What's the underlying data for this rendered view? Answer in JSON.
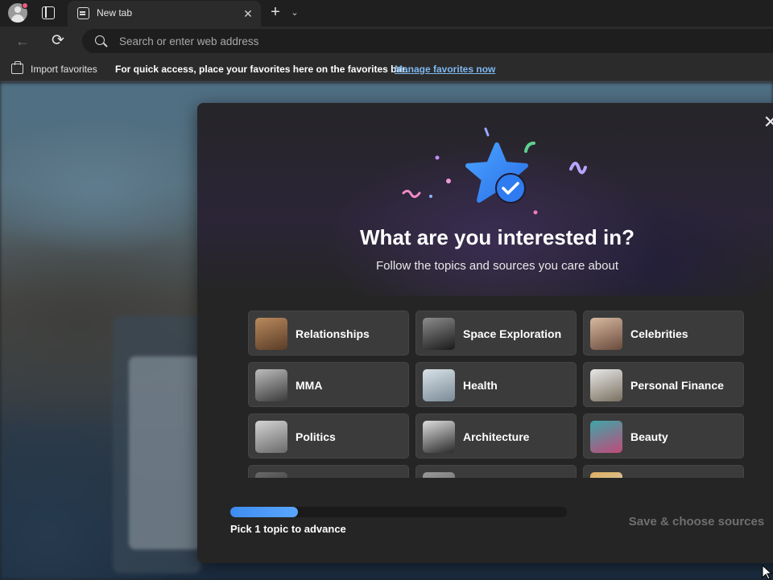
{
  "tab": {
    "title": "New tab",
    "close": "✕"
  },
  "tabbar": {
    "new_tab": "+",
    "dropdown": "⌄"
  },
  "toolbar": {
    "back": "←",
    "refresh": "⟳",
    "search_placeholder": "Search or enter web address",
    "search_value": ""
  },
  "favorites_bar": {
    "import_label": "Import favorites",
    "message": "For quick access, place your favorites here on the favorites bar.",
    "manage_link": "Manage favorites now"
  },
  "dialog": {
    "close": "✕",
    "title": "What are you interested in?",
    "subtitle": "Follow the topics and sources you care about",
    "topics": [
      {
        "label": "Relationships",
        "thumb": [
          "#b98a5e",
          "#5a3c26"
        ]
      },
      {
        "label": "Space Exploration",
        "thumb": [
          "#8c8c8c",
          "#1a1a1a"
        ]
      },
      {
        "label": "Celebrities",
        "thumb": [
          "#d7b9a0",
          "#6a4a3c"
        ]
      },
      {
        "label": "MMA",
        "thumb": [
          "#bdbdbd",
          "#3a3a3a"
        ]
      },
      {
        "label": "Health",
        "thumb": [
          "#d9e2e8",
          "#7a8a96"
        ]
      },
      {
        "label": "Personal Finance",
        "thumb": [
          "#e8e8e8",
          "#7a7060"
        ]
      },
      {
        "label": "Politics",
        "thumb": [
          "#d4d4d4",
          "#6a6a6a"
        ]
      },
      {
        "label": "Architecture",
        "thumb": [
          "#dedede",
          "#2a2a2a"
        ]
      },
      {
        "label": "Beauty",
        "thumb": [
          "#3fa6a8",
          "#c04a7a"
        ]
      },
      {
        "label": "",
        "thumb": [
          "#6a6a6a",
          "#2a2a2a"
        ]
      },
      {
        "label": "",
        "thumb": [
          "#9a9a9a",
          "#5a5a5a"
        ]
      },
      {
        "label": "",
        "thumb": [
          "#e0b060",
          "#d0d0d0"
        ]
      }
    ],
    "progress": {
      "fraction": 0.2,
      "label": "Pick 1 topic to advance"
    },
    "save_label": "Save & choose sources"
  },
  "colors": {
    "accent": "#3d8cf0",
    "star": "#3b8cf5",
    "link": "#7fb8f0"
  }
}
